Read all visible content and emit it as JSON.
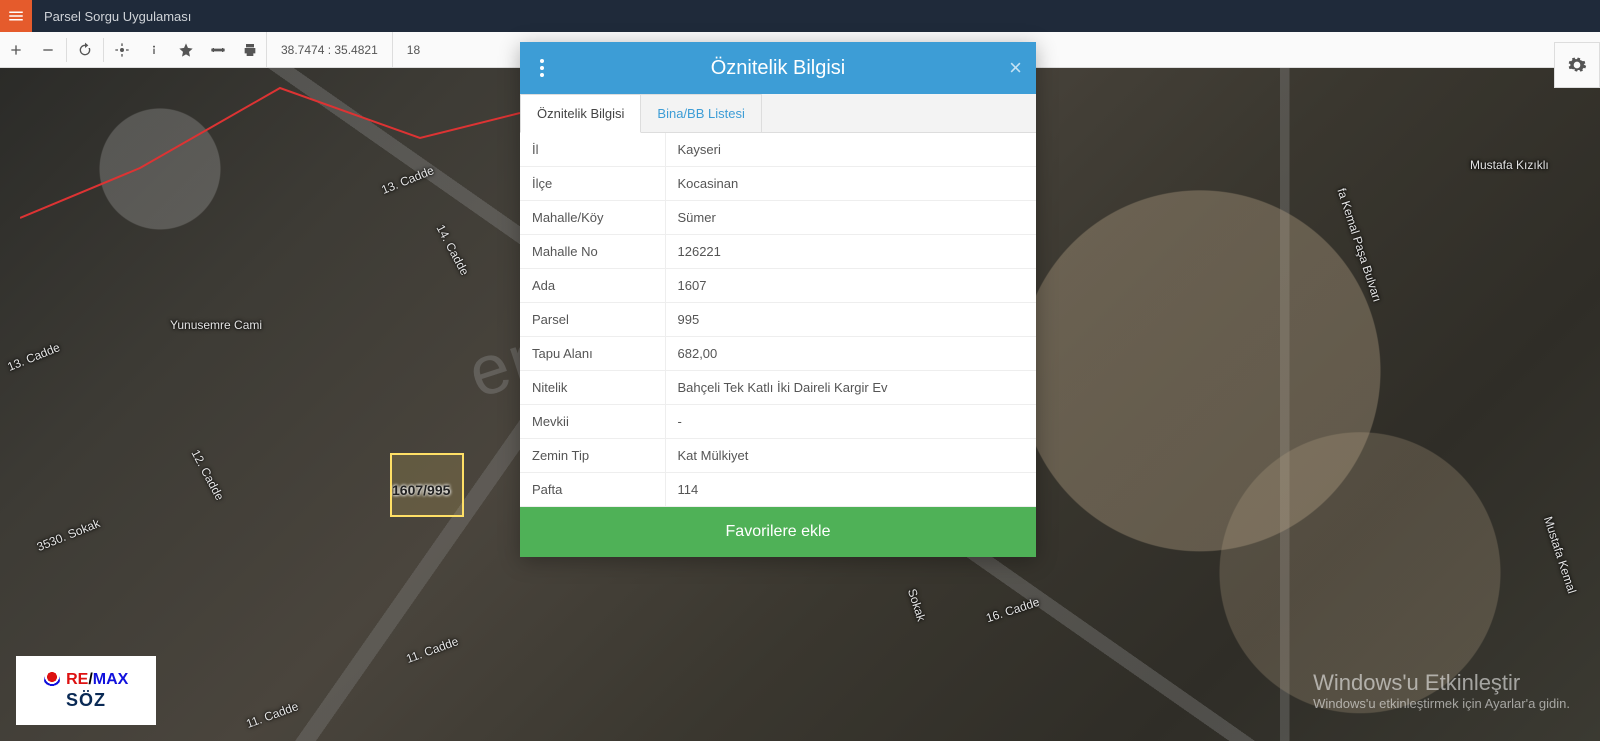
{
  "header": {
    "title": "Parsel Sorgu Uygulaması"
  },
  "toolbar": {
    "coords": "38.7474 : 35.4821",
    "zoom": "18"
  },
  "map": {
    "parcel_label": "1607/995",
    "labels": {
      "yunusemre": "Yunusemre Cami",
      "cadde13a": "13. Cadde",
      "cadde13b": "13. Cadde",
      "cadde14": "14. Cadde",
      "cadde12": "12. Cadde",
      "cadde11a": "11. Cadde",
      "cadde11b": "11. Cadde",
      "sokak3530": "3530. Sokak",
      "sokak_r": "Sokak",
      "cadde16": "16. Cadde",
      "mkemal1": "fa Kemal Paşa Bulvarı",
      "mkemal2": "Mustafa Kemal",
      "mkiz": "Mustafa Kızıklı"
    }
  },
  "watermark": "emlakjet.com",
  "logo": {
    "re": "RE",
    "slash": "/",
    "max": "MAX",
    "soz": "SÖZ"
  },
  "windows": {
    "line1": "Windows'u Etkinleştir",
    "line2": "Windows'u etkinleştirmek için Ayarlar'a gidin."
  },
  "modal": {
    "title": "Öznitelik Bilgisi",
    "tabs": {
      "attr": "Öznitelik Bilgisi",
      "bina": "Bina/BB Listesi"
    },
    "rows": [
      {
        "k": "İl",
        "v": "Kayseri"
      },
      {
        "k": "İlçe",
        "v": "Kocasinan"
      },
      {
        "k": "Mahalle/Köy",
        "v": "Sümer"
      },
      {
        "k": "Mahalle No",
        "v": "126221"
      },
      {
        "k": "Ada",
        "v": "1607"
      },
      {
        "k": "Parsel",
        "v": "995"
      },
      {
        "k": "Tapu Alanı",
        "v": "682,00"
      },
      {
        "k": "Nitelik",
        "v": "Bahçeli Tek Katlı İki Daireli Kargir Ev"
      },
      {
        "k": "Mevkii",
        "v": "-"
      },
      {
        "k": "Zemin Tip",
        "v": "Kat Mülkiyet"
      },
      {
        "k": "Pafta",
        "v": "114"
      }
    ],
    "favorite_btn": "Favorilere ekle"
  }
}
